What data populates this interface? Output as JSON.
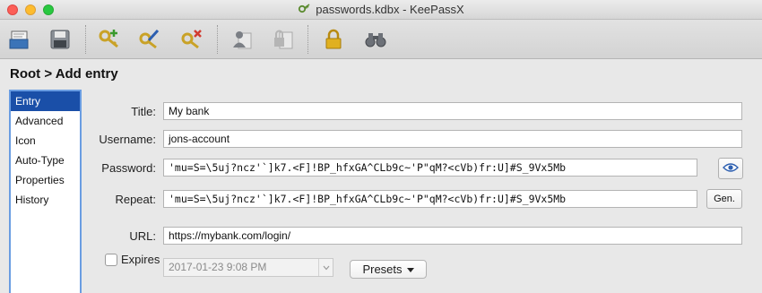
{
  "window": {
    "title": "passwords.kdbx - KeePassX"
  },
  "toolbar": {
    "buttons": [
      {
        "icon": "open-database-icon"
      },
      {
        "icon": "save-database-icon"
      },
      {
        "icon": "add-entry-icon"
      },
      {
        "icon": "edit-entry-icon"
      },
      {
        "icon": "delete-entry-icon"
      },
      {
        "icon": "copy-username-icon"
      },
      {
        "icon": "copy-password-icon"
      },
      {
        "icon": "lock-database-icon"
      },
      {
        "icon": "search-binoculars-icon"
      }
    ]
  },
  "breadcrumb": "Root > Add entry",
  "sidebar": {
    "items": [
      {
        "label": "Entry",
        "active": true
      },
      {
        "label": "Advanced"
      },
      {
        "label": "Icon"
      },
      {
        "label": "Auto-Type"
      },
      {
        "label": "Properties"
      },
      {
        "label": "History"
      }
    ]
  },
  "form": {
    "title_label": "Title:",
    "title_value": "My bank",
    "username_label": "Username:",
    "username_value": "jons-account",
    "password_label": "Password:",
    "password_value": "'mu=S=\\5uj?ncz'`]k7.<F]!BP_hfxGA^CLb9c~'P\"qM?<cVb)fr:U]#S_9Vx5Mb",
    "repeat_label": "Repeat:",
    "repeat_value": "'mu=S=\\5uj?ncz'`]k7.<F]!BP_hfxGA^CLb9c~'P\"qM?<cVb)fr:U]#S_9Vx5Mb",
    "gen_label": "Gen.",
    "url_label": "URL:",
    "url_value": "https://mybank.com/login/",
    "expires_label": "Expires",
    "expires_checked": false,
    "expires_value": "2017-01-23 9:08 PM",
    "presets_label": "Presets"
  },
  "colors": {
    "selection": "#1a4fa8",
    "focus_border": "#6a9de2"
  }
}
